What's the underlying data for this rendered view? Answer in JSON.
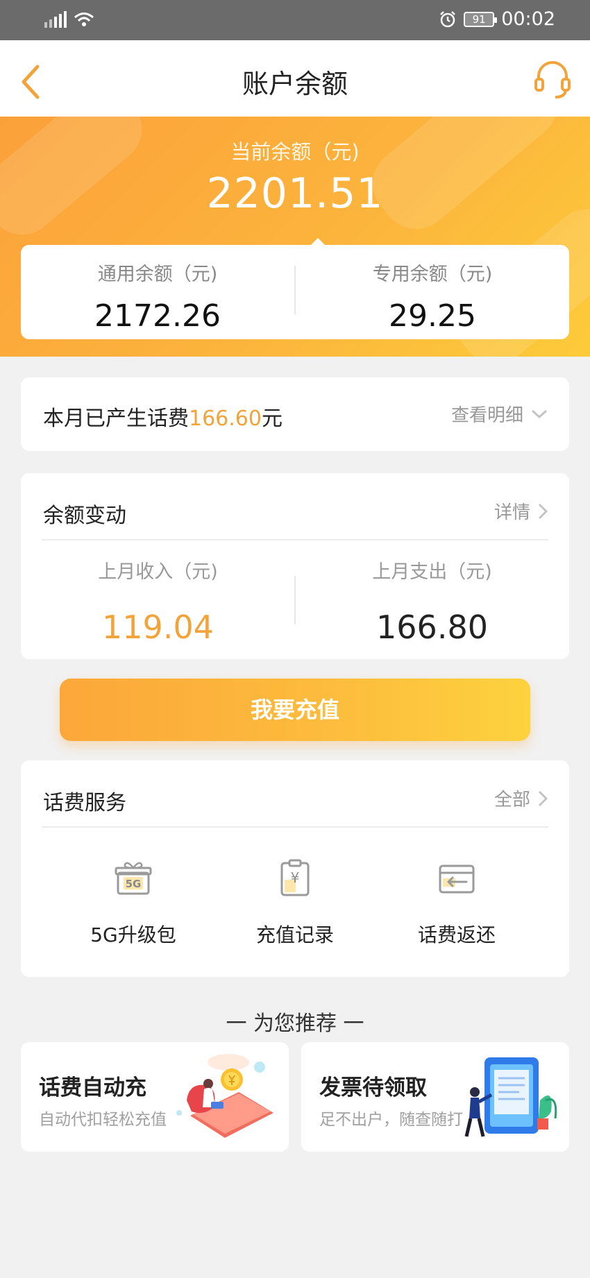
{
  "status_bar": {
    "time": "00:02",
    "battery": "91"
  },
  "nav": {
    "title": "账户余额"
  },
  "hero": {
    "label": "当前余额（元)",
    "amount": "2201.51",
    "general_label": "通用余额（元)",
    "general_value": "2172.26",
    "special_label": "专用余额（元)",
    "special_value": "29.25"
  },
  "monthly": {
    "text_prefix": "本月已产生话费",
    "amount": "166.60",
    "unit": "元",
    "detail_link": "查看明细"
  },
  "changes": {
    "title": "余额变动",
    "detail_link": "详情",
    "income_label": "上月收入（元)",
    "income_value": "119.04",
    "expense_label": "上月支出（元)",
    "expense_value": "166.80"
  },
  "recharge_button": "我要充值",
  "services": {
    "title": "话费服务",
    "all_link": "全部",
    "items": [
      {
        "label": "5G升级包",
        "icon": "gift-5g-icon"
      },
      {
        "label": "充值记录",
        "icon": "clipboard-yuan-icon"
      },
      {
        "label": "话费返还",
        "icon": "return-arrow-icon"
      }
    ],
    "badge_5g": "5G",
    "badge_yuan": "¥"
  },
  "recommend": {
    "title": "一 为您推荐 一",
    "cards": [
      {
        "title": "话费自动充",
        "subtitle": "自动代扣轻松充值"
      },
      {
        "title": "发票待领取",
        "subtitle": "足不出户，随查随打"
      }
    ]
  },
  "colors": {
    "accent": "#f2a43a",
    "hero_start": "#fba13a",
    "hero_end": "#fdcb3a"
  }
}
